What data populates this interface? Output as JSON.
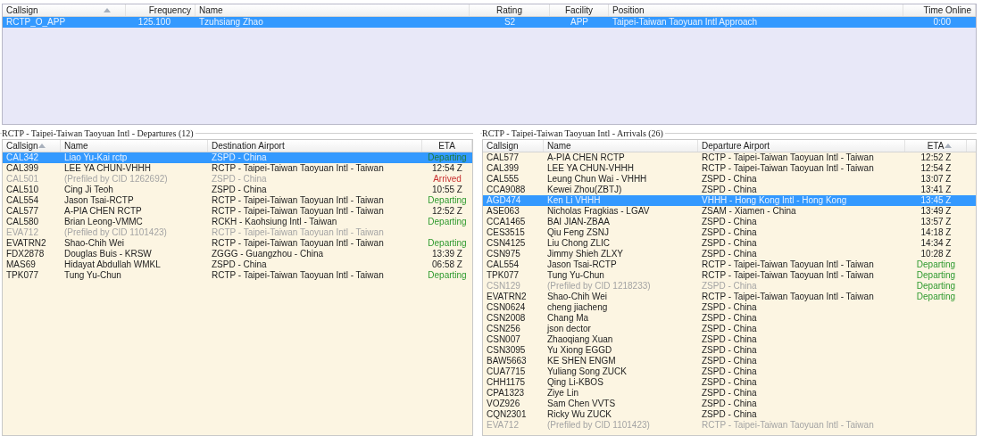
{
  "controllers": {
    "columns": [
      {
        "label": "Callsign",
        "sorted": true
      },
      {
        "label": "Frequency",
        "sorted": false
      },
      {
        "label": "Name",
        "sorted": false
      },
      {
        "label": "Rating",
        "sorted": false
      },
      {
        "label": "Facility",
        "sorted": false
      },
      {
        "label": "Position",
        "sorted": false
      },
      {
        "label": "Time Online",
        "sorted": false
      }
    ],
    "rows": [
      {
        "callsign": "RCTP_O_APP",
        "frequency": "125.100",
        "name": "Tzuhsiang Zhao",
        "rating": "S2",
        "facility": "APP",
        "position": "Taipei-Taiwan Taoyuan Intl Approach",
        "time_online": "0:00",
        "selected": true
      }
    ]
  },
  "departures": {
    "title": "RCTP - Taipei-Taiwan Taoyuan Intl - Departures (12)",
    "columns": [
      {
        "label": "Callsign",
        "sorted": true
      },
      {
        "label": "Name",
        "sorted": false
      },
      {
        "label": "Destination Airport",
        "sorted": false
      },
      {
        "label": "ETA",
        "sorted": false
      }
    ],
    "rows": [
      {
        "callsign": "CAL342",
        "name": "Liao Yu-Kai rctp",
        "airport": "ZSPD - China",
        "eta": "Departing",
        "kind": "departing",
        "prefiled": false,
        "selected": true
      },
      {
        "callsign": "CAL399",
        "name": "LEE YA CHUN-VHHH",
        "airport": "RCTP - Taipei-Taiwan Taoyuan Intl - Taiwan",
        "eta": "12:54 Z",
        "kind": "time",
        "prefiled": false,
        "selected": false
      },
      {
        "callsign": "CAL501",
        "name": "(Prefiled by CID 1262692)",
        "airport": "ZSPD - China",
        "eta": "Arrived",
        "kind": "arrived",
        "prefiled": true,
        "selected": false
      },
      {
        "callsign": "CAL510",
        "name": "Cing Ji Teoh",
        "airport": "ZSPD - China",
        "eta": "10:55 Z",
        "kind": "time",
        "prefiled": false,
        "selected": false
      },
      {
        "callsign": "CAL554",
        "name": "Jason Tsai-RCTP",
        "airport": "RCTP - Taipei-Taiwan Taoyuan Intl - Taiwan",
        "eta": "Departing",
        "kind": "departing",
        "prefiled": false,
        "selected": false
      },
      {
        "callsign": "CAL577",
        "name": "A-PIA CHEN RCTP",
        "airport": "RCTP - Taipei-Taiwan Taoyuan Intl - Taiwan",
        "eta": "12:52 Z",
        "kind": "time",
        "prefiled": false,
        "selected": false
      },
      {
        "callsign": "CAL580",
        "name": "Brian Leong-VMMC",
        "airport": "RCKH - Kaohsiung Intl - Taiwan",
        "eta": "Departing",
        "kind": "departing",
        "prefiled": false,
        "selected": false
      },
      {
        "callsign": "EVA712",
        "name": "(Prefiled by CID 1101423)",
        "airport": "RCTP - Taipei-Taiwan Taoyuan Intl - Taiwan",
        "prefiled": true,
        "selected": false
      },
      {
        "callsign": "EVATRN2",
        "name": "Shao-Chih Wei",
        "airport": "RCTP - Taipei-Taiwan Taoyuan Intl - Taiwan",
        "eta": "Departing",
        "kind": "departing",
        "prefiled": false,
        "selected": false
      },
      {
        "callsign": "FDX2878",
        "name": "Douglas Buis - KRSW",
        "airport": "ZGGG - Guangzhou - China",
        "eta": "13:39 Z",
        "kind": "time",
        "prefiled": false,
        "selected": false
      },
      {
        "callsign": "MAS69",
        "name": "Hidayat Abdullah WMKL",
        "airport": "ZSPD - China",
        "eta": "06:58 Z",
        "kind": "time",
        "prefiled": false,
        "selected": false
      },
      {
        "callsign": "TPK077",
        "name": "Tung Yu-Chun",
        "airport": "RCTP - Taipei-Taiwan Taoyuan Intl - Taiwan",
        "eta": "Departing",
        "kind": "departing",
        "prefiled": false,
        "selected": false
      }
    ]
  },
  "arrivals": {
    "title": "RCTP - Taipei-Taiwan Taoyuan Intl - Arrivals (26)",
    "columns": [
      {
        "label": "Callsign",
        "sorted": false
      },
      {
        "label": "Name",
        "sorted": false
      },
      {
        "label": "Departure Airport",
        "sorted": false
      },
      {
        "label": "ETA",
        "sorted": true
      }
    ],
    "rows": [
      {
        "callsign": "CAL577",
        "name": "A-PIA CHEN RCTP",
        "airport": "RCTP - Taipei-Taiwan Taoyuan Intl - Taiwan",
        "eta": "12:52 Z",
        "kind": "time",
        "prefiled": false,
        "selected": false
      },
      {
        "callsign": "CAL399",
        "name": "LEE YA CHUN-VHHH",
        "airport": "RCTP - Taipei-Taiwan Taoyuan Intl - Taiwan",
        "eta": "12:54 Z",
        "kind": "time",
        "prefiled": false,
        "selected": false
      },
      {
        "callsign": "CAL555",
        "name": "Leung Chun Wai - VHHH",
        "airport": "ZSPD - China",
        "eta": "13:07 Z",
        "kind": "time",
        "prefiled": false,
        "selected": false
      },
      {
        "callsign": "CCA9088",
        "name": "Kewei Zhou(ZBTJ)",
        "airport": "ZSPD - China",
        "eta": "13:41 Z",
        "kind": "time",
        "prefiled": false,
        "selected": false
      },
      {
        "callsign": "AGD474",
        "name": "Ken Li VHHH",
        "airport": "VHHH - Hong Kong Intl - Hong Kong",
        "eta": "13:45 Z",
        "kind": "time",
        "prefiled": false,
        "selected": true
      },
      {
        "callsign": "ASE063",
        "name": "Nicholas Fragkias - LGAV",
        "airport": "ZSAM - Xiamen - China",
        "eta": "13:49 Z",
        "kind": "time",
        "prefiled": false,
        "selected": false
      },
      {
        "callsign": "CCA1465",
        "name": "BAI JIAN-ZBAA",
        "airport": "ZSPD - China",
        "eta": "13:57 Z",
        "kind": "time",
        "prefiled": false,
        "selected": false
      },
      {
        "callsign": "CES3515",
        "name": "Qiu Feng ZSNJ",
        "airport": "ZSPD - China",
        "eta": "14:18 Z",
        "kind": "time",
        "prefiled": false,
        "selected": false
      },
      {
        "callsign": "CSN4125",
        "name": "Liu Chong ZLIC",
        "airport": "ZSPD - China",
        "eta": "14:34 Z",
        "kind": "time",
        "prefiled": false,
        "selected": false
      },
      {
        "callsign": "CSN975",
        "name": "Jimmy Shieh ZLXY",
        "airport": "ZSPD - China",
        "eta": "10:28 Z",
        "kind": "time",
        "prefiled": false,
        "selected": false
      },
      {
        "callsign": "CAL554",
        "name": "Jason Tsai-RCTP",
        "airport": "RCTP - Taipei-Taiwan Taoyuan Intl - Taiwan",
        "eta": "Departing",
        "kind": "departing",
        "prefiled": false,
        "selected": false
      },
      {
        "callsign": "TPK077",
        "name": "Tung Yu-Chun",
        "airport": "RCTP - Taipei-Taiwan Taoyuan Intl - Taiwan",
        "eta": "Departing",
        "kind": "departing",
        "prefiled": false,
        "selected": false
      },
      {
        "callsign": "CSN129",
        "name": "(Prefiled by CID 1218233)",
        "airport": "ZSPD - China",
        "eta": "Departing",
        "kind": "departing",
        "prefiled": true,
        "selected": false
      },
      {
        "callsign": "EVATRN2",
        "name": "Shao-Chih Wei",
        "airport": "RCTP - Taipei-Taiwan Taoyuan Intl - Taiwan",
        "eta": "Departing",
        "kind": "departing",
        "prefiled": false,
        "selected": false
      },
      {
        "callsign": "CSN0624",
        "name": "cheng jiacheng",
        "airport": "ZSPD - China",
        "prefiled": false,
        "selected": false
      },
      {
        "callsign": "CSN2008",
        "name": "Chang Ma",
        "airport": "ZSPD - China",
        "prefiled": false,
        "selected": false
      },
      {
        "callsign": "CSN256",
        "name": "json dector",
        "airport": "ZSPD - China",
        "prefiled": false,
        "selected": false
      },
      {
        "callsign": "CSN007",
        "name": "Zhaoqiang Xuan",
        "airport": "ZSPD - China",
        "prefiled": false,
        "selected": false
      },
      {
        "callsign": "CSN3095",
        "name": "Yu Xiong EGGD",
        "airport": "ZSPD - China",
        "prefiled": false,
        "selected": false
      },
      {
        "callsign": "BAW5663",
        "name": "KE SHEN ENGM",
        "airport": "ZSPD - China",
        "prefiled": false,
        "selected": false
      },
      {
        "callsign": "CUA7715",
        "name": "Yuliang Song ZUCK",
        "airport": "ZSPD - China",
        "prefiled": false,
        "selected": false
      },
      {
        "callsign": "CHH1175",
        "name": "Qing Li-KBOS",
        "airport": "ZSPD - China",
        "prefiled": false,
        "selected": false
      },
      {
        "callsign": "CPA1323",
        "name": "Ziye Lin",
        "airport": "ZSPD - China",
        "prefiled": false,
        "selected": false
      },
      {
        "callsign": "VOZ926",
        "name": "Sam Chen VVTS",
        "airport": "ZSPD - China",
        "prefiled": false,
        "selected": false
      },
      {
        "callsign": "CQN2301",
        "name": "Ricky Wu ZUCK",
        "airport": "ZSPD - China",
        "prefiled": false,
        "selected": false
      },
      {
        "callsign": "EVA712",
        "name": "(Prefiled by CID 1101423)",
        "airport": "RCTP - Taipei-Taiwan Taoyuan Intl - Taiwan",
        "prefiled": true,
        "selected": false
      }
    ]
  }
}
